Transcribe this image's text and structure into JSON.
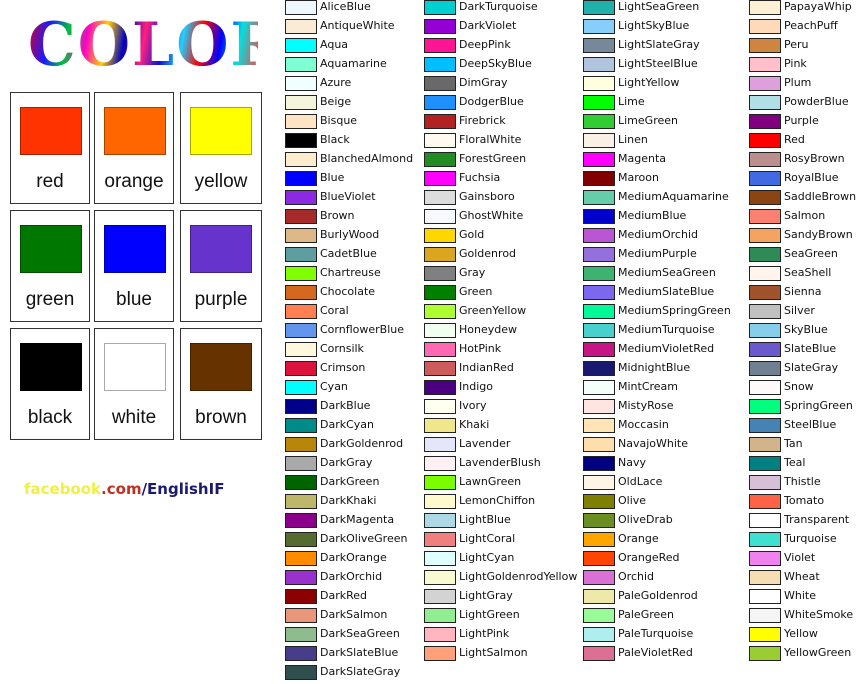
{
  "title": "COLOR",
  "cards": [
    {
      "label": "red",
      "color": "#ff3300"
    },
    {
      "label": "orange",
      "color": "#ff6600"
    },
    {
      "label": "yellow",
      "color": "#ffff00"
    },
    {
      "label": "green",
      "color": "#007700"
    },
    {
      "label": "blue",
      "color": "#0000ff"
    },
    {
      "label": "purple",
      "color": "#6633cc"
    },
    {
      "label": "black",
      "color": "#000000"
    },
    {
      "label": "white",
      "color": "#ffffff"
    },
    {
      "label": "brown",
      "color": "#663300"
    }
  ],
  "footer": {
    "part1": "facebook",
    "part2": ".com",
    "part3": "/EnglishIF"
  },
  "columns": [
    [
      {
        "name": "AliceBlue",
        "color": "#F0F8FF"
      },
      {
        "name": "AntiqueWhite",
        "color": "#FAEBD7"
      },
      {
        "name": "Aqua",
        "color": "#00FFFF"
      },
      {
        "name": "Aquamarine",
        "color": "#7FFFD4"
      },
      {
        "name": "Azure",
        "color": "#F0FFFF"
      },
      {
        "name": "Beige",
        "color": "#F5F5DC"
      },
      {
        "name": "Bisque",
        "color": "#FFE4C4"
      },
      {
        "name": "Black",
        "color": "#000000"
      },
      {
        "name": "BlanchedAlmond",
        "color": "#FFEBCD"
      },
      {
        "name": "Blue",
        "color": "#0000FF"
      },
      {
        "name": "BlueViolet",
        "color": "#8A2BE2"
      },
      {
        "name": "Brown",
        "color": "#A52A2A"
      },
      {
        "name": "BurlyWood",
        "color": "#DEB887"
      },
      {
        "name": "CadetBlue",
        "color": "#5F9EA0"
      },
      {
        "name": "Chartreuse",
        "color": "#7FFF00"
      },
      {
        "name": "Chocolate",
        "color": "#D2691E"
      },
      {
        "name": "Coral",
        "color": "#FF7F50"
      },
      {
        "name": "CornflowerBlue",
        "color": "#6495ED"
      },
      {
        "name": "Cornsilk",
        "color": "#FFF8DC"
      },
      {
        "name": "Crimson",
        "color": "#DC143C"
      },
      {
        "name": "Cyan",
        "color": "#00FFFF"
      },
      {
        "name": "DarkBlue",
        "color": "#00008B"
      },
      {
        "name": "DarkCyan",
        "color": "#008B8B"
      },
      {
        "name": "DarkGoldenrod",
        "color": "#B8860B"
      },
      {
        "name": "DarkGray",
        "color": "#A9A9A9"
      },
      {
        "name": "DarkGreen",
        "color": "#006400"
      },
      {
        "name": "DarkKhaki",
        "color": "#BDB76B"
      },
      {
        "name": "DarkMagenta",
        "color": "#8B008B"
      },
      {
        "name": "DarkOliveGreen",
        "color": "#556B2F"
      },
      {
        "name": "DarkOrange",
        "color": "#FF8C00"
      },
      {
        "name": "DarkOrchid",
        "color": "#9932CC"
      },
      {
        "name": "DarkRed",
        "color": "#8B0000"
      },
      {
        "name": "DarkSalmon",
        "color": "#E9967A"
      },
      {
        "name": "DarkSeaGreen",
        "color": "#8FBC8F"
      },
      {
        "name": "DarkSlateBlue",
        "color": "#483D8B"
      },
      {
        "name": "DarkSlateGray",
        "color": "#2F4F4F"
      }
    ],
    [
      {
        "name": "DarkTurquoise",
        "color": "#00CED1"
      },
      {
        "name": "DarkViolet",
        "color": "#9400D3"
      },
      {
        "name": "DeepPink",
        "color": "#FF1493"
      },
      {
        "name": "DeepSkyBlue",
        "color": "#00BFFF"
      },
      {
        "name": "DimGray",
        "color": "#696969"
      },
      {
        "name": "DodgerBlue",
        "color": "#1E90FF"
      },
      {
        "name": "Firebrick",
        "color": "#B22222"
      },
      {
        "name": "FloralWhite",
        "color": "#FFFAF0"
      },
      {
        "name": "ForestGreen",
        "color": "#228B22"
      },
      {
        "name": "Fuchsia",
        "color": "#FF00FF"
      },
      {
        "name": "Gainsboro",
        "color": "#DCDCDC"
      },
      {
        "name": "GhostWhite",
        "color": "#F8F8FF"
      },
      {
        "name": "Gold",
        "color": "#FFD700"
      },
      {
        "name": "Goldenrod",
        "color": "#DAA520"
      },
      {
        "name": "Gray",
        "color": "#808080"
      },
      {
        "name": "Green",
        "color": "#008000"
      },
      {
        "name": "GreenYellow",
        "color": "#ADFF2F"
      },
      {
        "name": "Honeydew",
        "color": "#F0FFF0"
      },
      {
        "name": "HotPink",
        "color": "#FF69B4"
      },
      {
        "name": "IndianRed",
        "color": "#CD5C5C"
      },
      {
        "name": "Indigo",
        "color": "#4B0082"
      },
      {
        "name": "Ivory",
        "color": "#FFFFF0"
      },
      {
        "name": "Khaki",
        "color": "#F0E68C"
      },
      {
        "name": "Lavender",
        "color": "#E6E6FA"
      },
      {
        "name": "LavenderBlush",
        "color": "#FFF0F5"
      },
      {
        "name": "LawnGreen",
        "color": "#7CFC00"
      },
      {
        "name": "LemonChiffon",
        "color": "#FFFACD"
      },
      {
        "name": "LightBlue",
        "color": "#ADD8E6"
      },
      {
        "name": "LightCoral",
        "color": "#F08080"
      },
      {
        "name": "LightCyan",
        "color": "#E0FFFF"
      },
      {
        "name": "LightGoldenrodYellow",
        "color": "#FAFAD2"
      },
      {
        "name": "LightGray",
        "color": "#D3D3D3"
      },
      {
        "name": "LightGreen",
        "color": "#90EE90"
      },
      {
        "name": "LightPink",
        "color": "#FFB6C1"
      },
      {
        "name": "LightSalmon",
        "color": "#FFA07A"
      }
    ],
    [
      {
        "name": "LightSeaGreen",
        "color": "#20B2AA"
      },
      {
        "name": "LightSkyBlue",
        "color": "#87CEFA"
      },
      {
        "name": "LightSlateGray",
        "color": "#778899"
      },
      {
        "name": "LightSteelBlue",
        "color": "#B0C4DE"
      },
      {
        "name": "LightYellow",
        "color": "#FFFFE0"
      },
      {
        "name": "Lime",
        "color": "#00FF00"
      },
      {
        "name": "LimeGreen",
        "color": "#32CD32"
      },
      {
        "name": "Linen",
        "color": "#FAF0E6"
      },
      {
        "name": "Magenta",
        "color": "#FF00FF"
      },
      {
        "name": "Maroon",
        "color": "#800000"
      },
      {
        "name": "MediumAquamarine",
        "color": "#66CDAA"
      },
      {
        "name": "MediumBlue",
        "color": "#0000CD"
      },
      {
        "name": "MediumOrchid",
        "color": "#BA55D3"
      },
      {
        "name": "MediumPurple",
        "color": "#9370DB"
      },
      {
        "name": "MediumSeaGreen",
        "color": "#3CB371"
      },
      {
        "name": "MediumSlateBlue",
        "color": "#7B68EE"
      },
      {
        "name": "MediumSpringGreen",
        "color": "#00FA9A"
      },
      {
        "name": "MediumTurquoise",
        "color": "#48D1CC"
      },
      {
        "name": "MediumVioletRed",
        "color": "#C71585"
      },
      {
        "name": "MidnightBlue",
        "color": "#191970"
      },
      {
        "name": "MintCream",
        "color": "#F5FFFA"
      },
      {
        "name": "MistyRose",
        "color": "#FFE4E1"
      },
      {
        "name": "Moccasin",
        "color": "#FFE4B5"
      },
      {
        "name": "NavajoWhite",
        "color": "#FFDEAD"
      },
      {
        "name": "Navy",
        "color": "#000080"
      },
      {
        "name": "OldLace",
        "color": "#FDF5E6"
      },
      {
        "name": "Olive",
        "color": "#808000"
      },
      {
        "name": "OliveDrab",
        "color": "#6B8E23"
      },
      {
        "name": "Orange",
        "color": "#FFA500"
      },
      {
        "name": "OrangeRed",
        "color": "#FF4500"
      },
      {
        "name": "Orchid",
        "color": "#DA70D6"
      },
      {
        "name": "PaleGoldenrod",
        "color": "#EEE8AA"
      },
      {
        "name": "PaleGreen",
        "color": "#98FB98"
      },
      {
        "name": "PaleTurquoise",
        "color": "#AFEEEE"
      },
      {
        "name": "PaleVioletRed",
        "color": "#DB7093"
      }
    ],
    [
      {
        "name": "PapayaWhip",
        "color": "#FFEFD5"
      },
      {
        "name": "PeachPuff",
        "color": "#FFDAB9"
      },
      {
        "name": "Peru",
        "color": "#CD853F"
      },
      {
        "name": "Pink",
        "color": "#FFC0CB"
      },
      {
        "name": "Plum",
        "color": "#DDA0DD"
      },
      {
        "name": "PowderBlue",
        "color": "#B0E0E6"
      },
      {
        "name": "Purple",
        "color": "#800080"
      },
      {
        "name": "Red",
        "color": "#FF0000"
      },
      {
        "name": "RosyBrown",
        "color": "#BC8F8F"
      },
      {
        "name": "RoyalBlue",
        "color": "#4169E1"
      },
      {
        "name": "SaddleBrown",
        "color": "#8B4513"
      },
      {
        "name": "Salmon",
        "color": "#FA8072"
      },
      {
        "name": "SandyBrown",
        "color": "#F4A460"
      },
      {
        "name": "SeaGreen",
        "color": "#2E8B57"
      },
      {
        "name": "SeaShell",
        "color": "#FFF5EE"
      },
      {
        "name": "Sienna",
        "color": "#A0522D"
      },
      {
        "name": "Silver",
        "color": "#C0C0C0"
      },
      {
        "name": "SkyBlue",
        "color": "#87CEEB"
      },
      {
        "name": "SlateBlue",
        "color": "#6A5ACD"
      },
      {
        "name": "SlateGray",
        "color": "#708090"
      },
      {
        "name": "Snow",
        "color": "#FFFAFA"
      },
      {
        "name": "SpringGreen",
        "color": "#00FF7F"
      },
      {
        "name": "SteelBlue",
        "color": "#4682B4"
      },
      {
        "name": "Tan",
        "color": "#D2B48C"
      },
      {
        "name": "Teal",
        "color": "#008080"
      },
      {
        "name": "Thistle",
        "color": "#D8BFD8"
      },
      {
        "name": "Tomato",
        "color": "#FF6347"
      },
      {
        "name": "Transparent",
        "color": "#FFFFFF"
      },
      {
        "name": "Turquoise",
        "color": "#40E0D0"
      },
      {
        "name": "Violet",
        "color": "#EE82EE"
      },
      {
        "name": "Wheat",
        "color": "#F5DEB3"
      },
      {
        "name": "White",
        "color": "#FFFFFF"
      },
      {
        "name": "WhiteSmoke",
        "color": "#F5F5F5"
      },
      {
        "name": "Yellow",
        "color": "#FFFF00"
      },
      {
        "name": "YellowGreen",
        "color": "#9ACD32"
      }
    ]
  ]
}
